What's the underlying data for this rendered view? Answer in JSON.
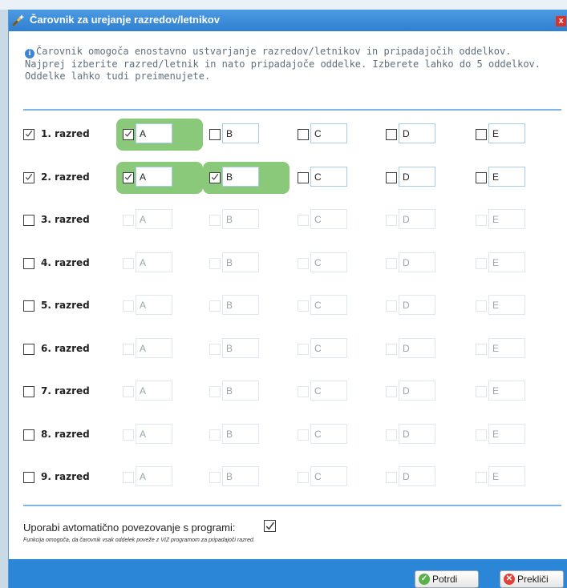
{
  "dialog": {
    "title": "Čarovnik za urejanje razredov/letnikov",
    "close_label": "x",
    "info_lines": [
      "Čarovnik omogoča enostavno ustvarjanje razredov/letnikov in pripadajočih oddelkov.",
      "Najprej izberite razred/letnik in nato pripadajoče oddelke. Izberete lahko do 5 oddelkov.",
      "Oddelke lahko tudi preimenujete."
    ]
  },
  "grades": [
    {
      "label": "1. razred",
      "checked": true,
      "depts": [
        {
          "name": "A",
          "checked": true
        },
        {
          "name": "B",
          "checked": false
        },
        {
          "name": "C",
          "checked": false
        },
        {
          "name": "D",
          "checked": false
        },
        {
          "name": "E",
          "checked": false
        }
      ]
    },
    {
      "label": "2. razred",
      "checked": true,
      "depts": [
        {
          "name": "A",
          "checked": true
        },
        {
          "name": "B",
          "checked": true
        },
        {
          "name": "C",
          "checked": false
        },
        {
          "name": "D",
          "checked": false
        },
        {
          "name": "E",
          "checked": false
        }
      ]
    },
    {
      "label": "3. razred",
      "checked": false,
      "depts": [
        {
          "name": "A",
          "checked": false
        },
        {
          "name": "B",
          "checked": false
        },
        {
          "name": "C",
          "checked": false
        },
        {
          "name": "D",
          "checked": false
        },
        {
          "name": "E",
          "checked": false
        }
      ]
    },
    {
      "label": "4. razred",
      "checked": false,
      "depts": [
        {
          "name": "A",
          "checked": false
        },
        {
          "name": "B",
          "checked": false
        },
        {
          "name": "C",
          "checked": false
        },
        {
          "name": "D",
          "checked": false
        },
        {
          "name": "E",
          "checked": false
        }
      ]
    },
    {
      "label": "5. razred",
      "checked": false,
      "depts": [
        {
          "name": "A",
          "checked": false
        },
        {
          "name": "B",
          "checked": false
        },
        {
          "name": "C",
          "checked": false
        },
        {
          "name": "D",
          "checked": false
        },
        {
          "name": "E",
          "checked": false
        }
      ]
    },
    {
      "label": "6. razred",
      "checked": false,
      "depts": [
        {
          "name": "A",
          "checked": false
        },
        {
          "name": "B",
          "checked": false
        },
        {
          "name": "C",
          "checked": false
        },
        {
          "name": "D",
          "checked": false
        },
        {
          "name": "E",
          "checked": false
        }
      ]
    },
    {
      "label": "7. razred",
      "checked": false,
      "depts": [
        {
          "name": "A",
          "checked": false
        },
        {
          "name": "B",
          "checked": false
        },
        {
          "name": "C",
          "checked": false
        },
        {
          "name": "D",
          "checked": false
        },
        {
          "name": "E",
          "checked": false
        }
      ]
    },
    {
      "label": "8. razred",
      "checked": false,
      "depts": [
        {
          "name": "A",
          "checked": false
        },
        {
          "name": "B",
          "checked": false
        },
        {
          "name": "C",
          "checked": false
        },
        {
          "name": "D",
          "checked": false
        },
        {
          "name": "E",
          "checked": false
        }
      ]
    },
    {
      "label": "9. razred",
      "checked": false,
      "depts": [
        {
          "name": "A",
          "checked": false
        },
        {
          "name": "B",
          "checked": false
        },
        {
          "name": "C",
          "checked": false
        },
        {
          "name": "D",
          "checked": false
        },
        {
          "name": "E",
          "checked": false
        }
      ]
    }
  ],
  "auto_link": {
    "label": "Uporabi avtomatično povezovanje s programi:",
    "checked": true,
    "note": "Funkcija omogoča, da čarovnik vsak oddelek poveže z VIZ programom za pripadajoči razred."
  },
  "buttons": {
    "confirm": "Potrdi",
    "cancel": "Prekliči"
  },
  "icons": {
    "title": "wand-icon",
    "info": "info-icon",
    "confirm": "check-circle-icon",
    "cancel": "x-circle-icon"
  },
  "colors": {
    "titlebar": "#2f7fd0",
    "selected_highlight": "#8bc97a",
    "footer": "#2c86d8",
    "close": "#d9322a"
  }
}
